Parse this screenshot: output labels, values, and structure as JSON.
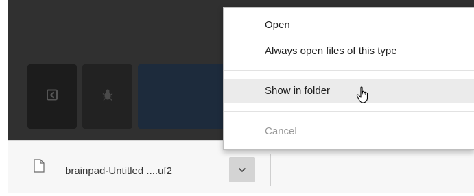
{
  "download_item": {
    "file_name": "brainpad-Untitled ....uf2",
    "file_icon": "file-icon",
    "menu_button_icon": "chevron-down-icon"
  },
  "background_tiles": [
    {
      "icon": "exit-icon"
    },
    {
      "icon": "bug-icon"
    },
    {
      "icon": ""
    }
  ],
  "context_menu": {
    "items": [
      {
        "label": "Open",
        "enabled": true,
        "highlighted": false
      },
      {
        "label": "Always open files of this type",
        "enabled": true,
        "highlighted": false
      },
      {
        "label": "Show in folder",
        "enabled": true,
        "highlighted": true
      },
      {
        "label": "Cancel",
        "enabled": false,
        "highlighted": false
      }
    ]
  },
  "cursor": {
    "icon": "hand-pointer-icon"
  },
  "colors": {
    "page_background": "#303030",
    "shelf_background": "#f7f7f7",
    "menu_highlight": "#ebebeb",
    "disabled_text": "#9a9a9a",
    "tile_blue": "#1d2b3c"
  }
}
